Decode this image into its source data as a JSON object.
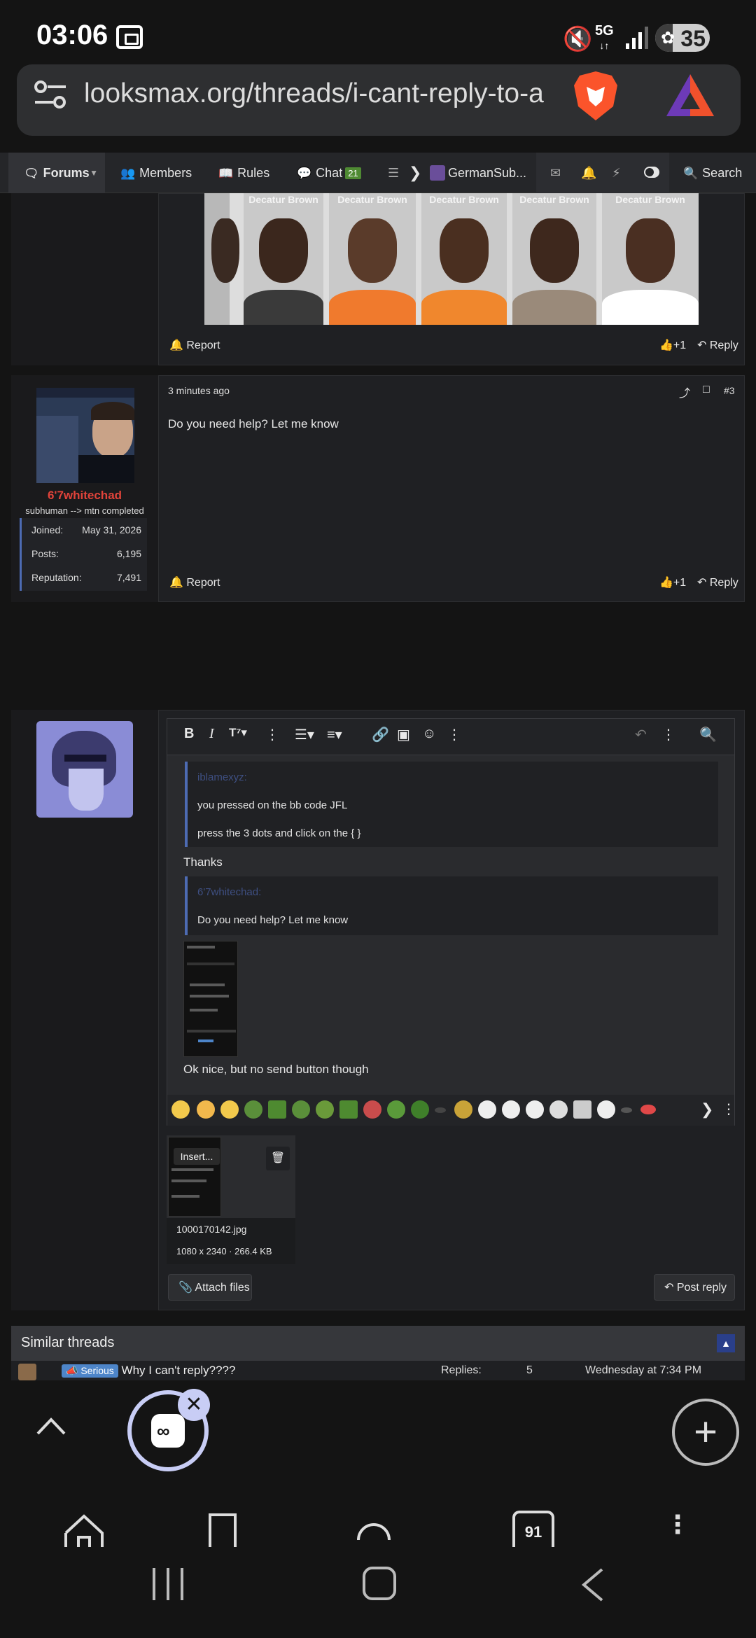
{
  "status_bar": {
    "time": "03:06",
    "network": "5G",
    "battery": "35"
  },
  "browser": {
    "url": "looksmax.org/threads/i-cant-reply-to-a"
  },
  "nav": {
    "forums": "Forums",
    "members": "Members",
    "rules": "Rules",
    "chat": "Chat",
    "chat_badge": "21",
    "germansub": "GermanSub...",
    "search": "Search"
  },
  "post_top": {
    "mug_caption": "Decatur Brown",
    "report": "Report",
    "like": "+1",
    "reply": "Reply"
  },
  "post_3": {
    "time": "3 minutes ago",
    "number": "#3",
    "body": "Do you need help? Let me know",
    "username": "6'7whitechad",
    "user_title": "subhuman --> mtn completed",
    "stats": [
      {
        "label": "Joined:",
        "value": "May 31, 2026"
      },
      {
        "label": "Posts:",
        "value": "6,195"
      },
      {
        "label": "Reputation:",
        "value": "7,491"
      }
    ],
    "report": "Report",
    "like": "+1",
    "reply": "Reply"
  },
  "editor": {
    "quote1_author": "iblamexyz:",
    "quote1_lines": [
      "you pressed on the bb code JFL",
      "press the 3 dots and click on the { }"
    ],
    "text1": "Thanks",
    "quote2_author": "6'7whitechad:",
    "quote2_lines": [
      "Do you need help? Let me know"
    ],
    "text2": "Ok nice, but no send button though"
  },
  "attachment": {
    "insert_label": "Insert...",
    "filename": "1000170142.jpg",
    "meta": "1080 x 2340 · 266.4 KB"
  },
  "buttons": {
    "attach": "Attach files",
    "post_reply": "Post reply"
  },
  "similar": {
    "title": "Similar threads",
    "tag": "Serious",
    "thread_title": "Why I can't reply????",
    "replies_label": "Replies:",
    "replies": "5",
    "date": "Wednesday at 7:34 PM"
  },
  "tab_count": "91",
  "colors": {
    "username": "#e0433a",
    "accent": "#4d6bb3",
    "badge": "#4f8a33"
  }
}
